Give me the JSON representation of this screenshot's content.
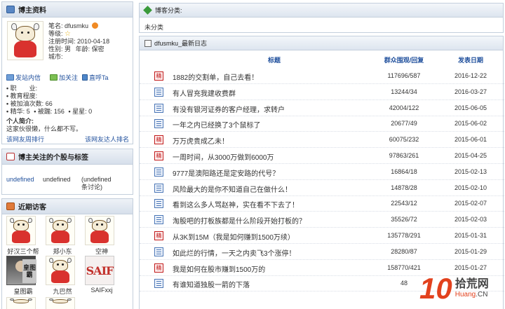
{
  "profile": {
    "title": "博主资料",
    "nickname_label": "笔名:",
    "nickname": "dfusmku",
    "level_label": "等级:",
    "register_label": "注册时间:",
    "register_date": "2010-04-18",
    "gender_label": "性别:",
    "gender": "男",
    "age_label": "年龄:",
    "age": "保密",
    "city_label": "城市:",
    "actions": {
      "message": "发站内信",
      "follow": "加关注",
      "shout": "直呼Ta"
    },
    "job_label": "职　　业:",
    "edu_label": "教育程度:",
    "refuel_label": "被加油次数:",
    "refuel_count": "66",
    "essence_label": "精华:",
    "essence_count": "5",
    "slap_label": "被踹:",
    "slap_count": "156",
    "star_label": "星星:",
    "star_count": "0",
    "intro_label": "个人简介:",
    "intro_text": "这家伙很懒，什么都不写。",
    "friend_rank_left": "该网友周排行",
    "friend_rank_right": "该网友达人排名"
  },
  "stocks": {
    "title": "博主关注的个股与标签",
    "items": [
      "undefined",
      "undefined",
      "(undefined",
      "条讨论)"
    ]
  },
  "visitors": {
    "title": "近期访客",
    "items": [
      {
        "name": "好汉三个帮"
      },
      {
        "name": "郑小东"
      },
      {
        "name": "空神"
      },
      {
        "name": "皇图霸"
      },
      {
        "name": "九巴然"
      },
      {
        "name": "SAIFxxj"
      }
    ],
    "chars_avatar": [
      "皇图",
      "霸"
    ],
    "saif_logo": "SAIF"
  },
  "category": {
    "title": "博客分类:",
    "value": "未分类"
  },
  "blog": {
    "title": "dfusmku_最新日志",
    "columns": {
      "title": "标题",
      "views": "群众围观/回复",
      "date": "发表日期"
    },
    "hot_mark": "精",
    "rows": [
      {
        "title": "1882的交割单，自己去看！",
        "views": "117696/587",
        "date": "2016-12-22",
        "hot": true
      },
      {
        "title": "有人冒充我建收费群",
        "views": "13244/34",
        "date": "2016-03-27",
        "hot": false
      },
      {
        "title": "有没有银河证券的客户经理，求转户",
        "views": "42004/122",
        "date": "2015-06-05",
        "hot": false
      },
      {
        "title": "一年之内已经换了3个鼠标了",
        "views": "20677/49",
        "date": "2015-06-02",
        "hot": false
      },
      {
        "title": "万万虎贵成乙未！",
        "views": "60075/232",
        "date": "2015-06-01",
        "hot": true
      },
      {
        "title": "一周时间，从3000万做到6000万",
        "views": "97863/261",
        "date": "2015-04-25",
        "hot": true
      },
      {
        "title": "9777是澳阳路还是定安路的代号？",
        "views": "16864/18",
        "date": "2015-02-13",
        "hot": false
      },
      {
        "title": "风险最大的是你不知道自己在做什么！",
        "views": "14878/28",
        "date": "2015-02-10",
        "hot": false
      },
      {
        "title": "看到这么多人骂赵神，实在看不下去了！",
        "views": "22543/12",
        "date": "2015-02-07",
        "hot": false
      },
      {
        "title": "淘股吧的打板族都是什么阶段开始打板的？",
        "views": "35526/72",
        "date": "2015-02-03",
        "hot": false
      },
      {
        "title": "从3K到15M（我是如何赚到1500万续）",
        "views": "135778/291",
        "date": "2015-01-31",
        "hot": true
      },
      {
        "title": "如此烂的行情，一天之内卖飞3个涨停！",
        "views": "28280/87",
        "date": "2015-01-29",
        "hot": false
      },
      {
        "title": "我是如何在股市赚到1500万的",
        "views": "158770/421",
        "date": "2015-01-27",
        "hot": true
      },
      {
        "title": "有谁知道独股一箭的下落",
        "views": "48",
        "date": "",
        "hot": false
      }
    ]
  },
  "watermark": {
    "number": "10",
    "name": "拾荒网",
    "url_main": "Huang",
    "url_suffix": ".CN"
  },
  "colors": {
    "link": "#1f4f9c",
    "hot": "#c01818",
    "border": "#c4cfdc",
    "watermark": "#e2411d"
  }
}
